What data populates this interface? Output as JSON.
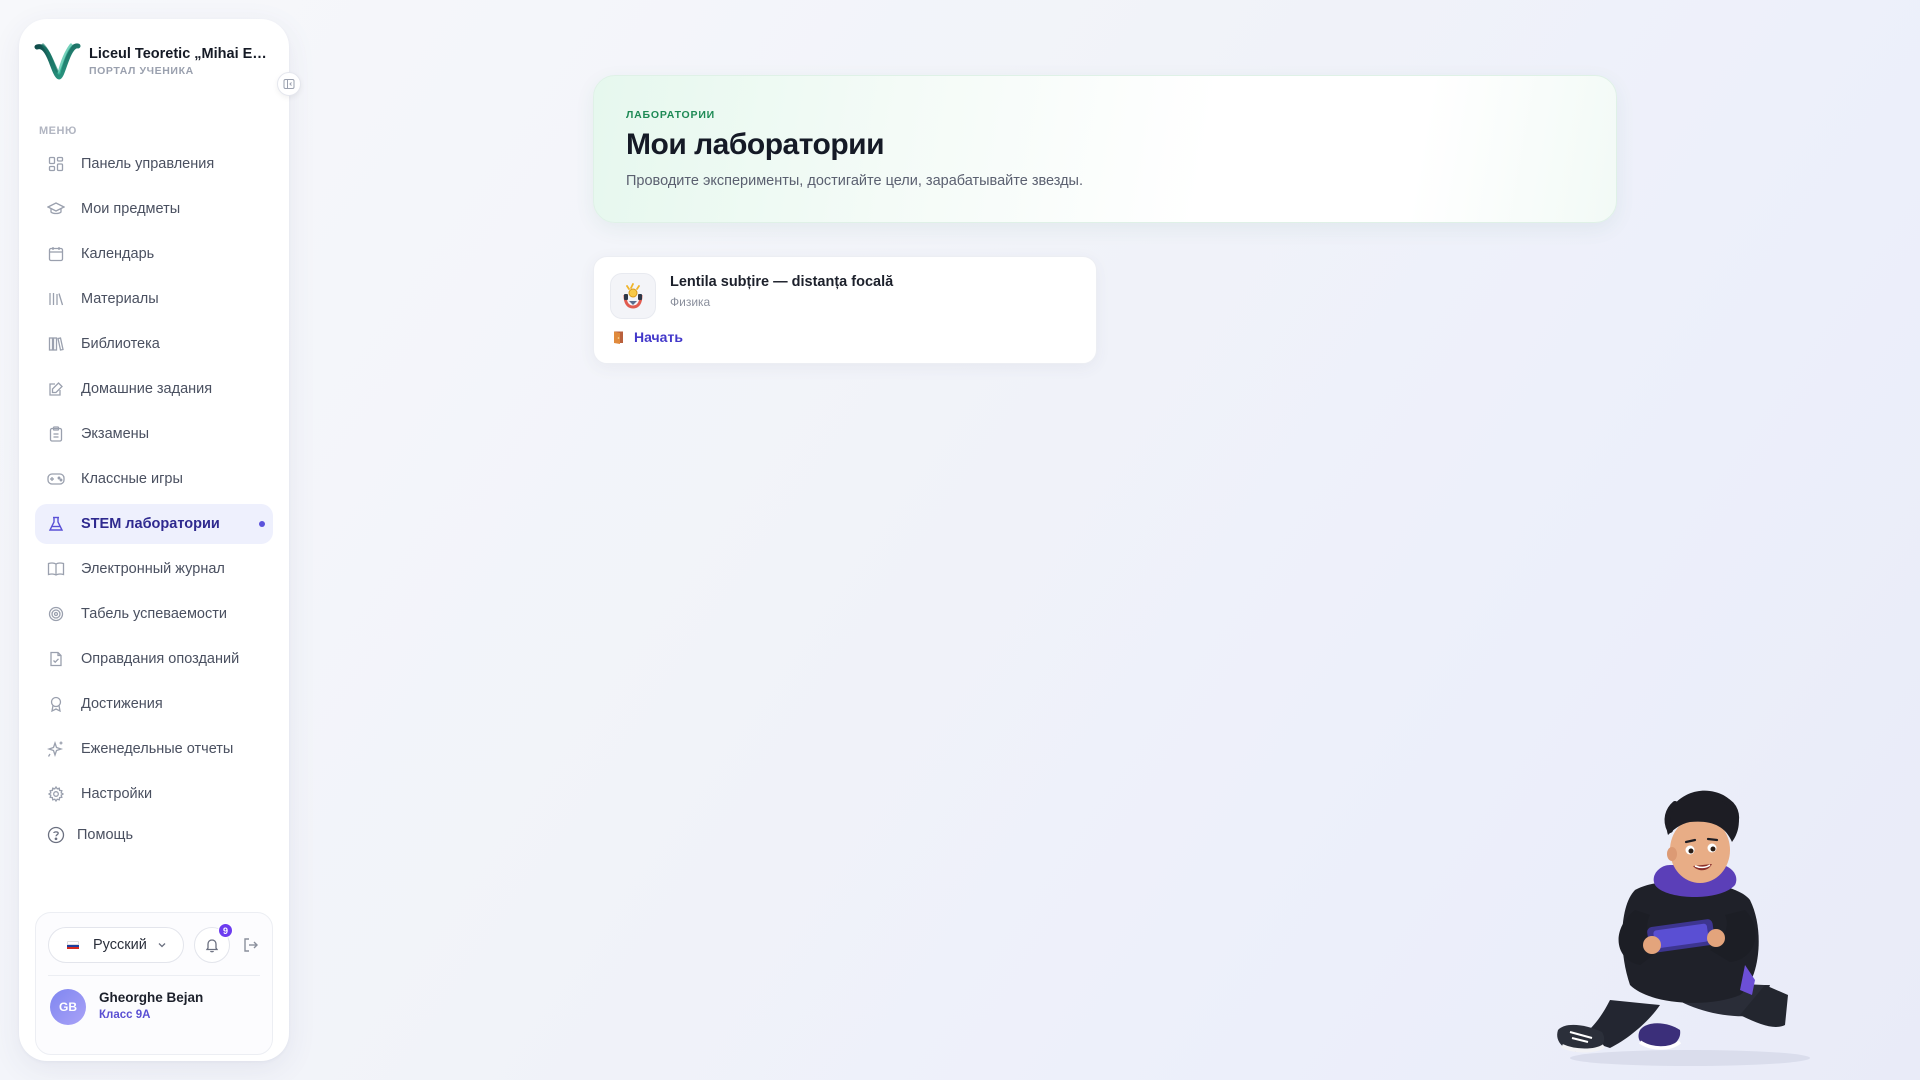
{
  "sidebar": {
    "brand_title": "Liceul Teoretic „Mihai Emi...",
    "brand_subtitle": "ПОРТАЛ УЧЕНИКА",
    "menu_heading": "МЕНЮ",
    "items": [
      {
        "label": "Панель управления",
        "icon": "dashboard-grid-icon"
      },
      {
        "label": "Мои предметы",
        "icon": "graduation-cap-icon"
      },
      {
        "label": "Календарь",
        "icon": "calendar-icon"
      },
      {
        "label": "Материалы",
        "icon": "library-books-icon"
      },
      {
        "label": "Библиотека",
        "icon": "books-shelf-icon"
      },
      {
        "label": "Домашние задания",
        "icon": "edit-note-icon"
      },
      {
        "label": "Экзамены",
        "icon": "clipboard-icon"
      },
      {
        "label": "Классные игры",
        "icon": "gamepad-icon"
      },
      {
        "label": "STEM лаборатории",
        "icon": "flask-icon",
        "active": true
      },
      {
        "label": "Электронный журнал",
        "icon": "open-book-icon"
      },
      {
        "label": "Табель успеваемости",
        "icon": "target-icon"
      },
      {
        "label": "Оправдания опозданий",
        "icon": "document-check-icon"
      },
      {
        "label": "Достижения",
        "icon": "award-icon"
      },
      {
        "label": "Еженедельные отчеты",
        "icon": "sparkles-icon"
      },
      {
        "label": "Настройки",
        "icon": "gear-icon"
      }
    ],
    "help_label": "Помощь",
    "language": "Русский",
    "notifications_count": "9",
    "user": {
      "initials": "GB",
      "name": "Gheorghe Bejan",
      "class": "Класс 9A"
    }
  },
  "hero": {
    "eyebrow": "ЛАБОРАТОРИИ",
    "title": "Мои лаборатории",
    "subtitle": "Проводите эксперименты, достигайте цели, зарабатывайте звезды."
  },
  "labs": [
    {
      "title": "Lentila subțire — distanța focală",
      "subject": "Физика",
      "action": "Начать"
    }
  ],
  "colors": {
    "accent": "#4338ca",
    "active_bg": "#eef0fd",
    "eyebrow_green": "#1e8a55",
    "badge": "#6d3cf0"
  }
}
